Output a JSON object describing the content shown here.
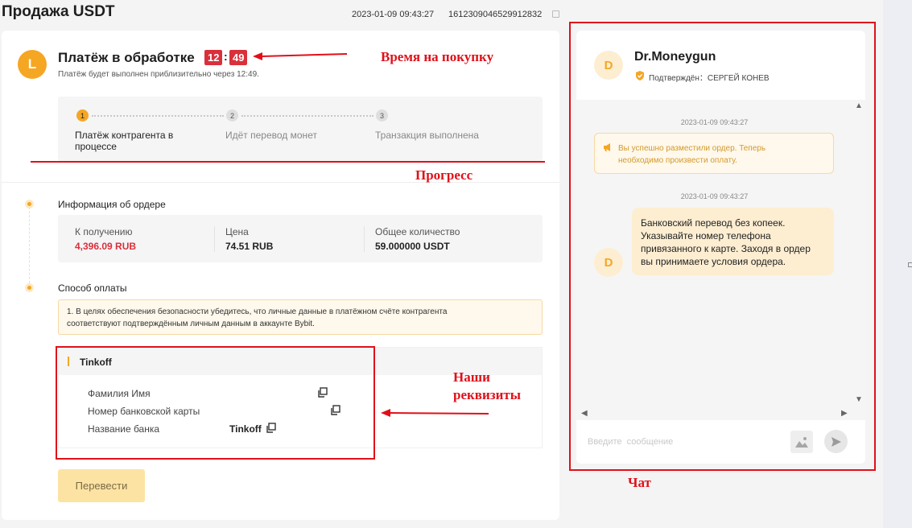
{
  "header": {
    "title": "Продажа USDT",
    "datetime": "2023-01-09 09:43:27",
    "order_id": "1612309046529912832"
  },
  "status": {
    "avatar_letter": "L",
    "title": "Платёж в обработке",
    "timer_minutes": "12",
    "timer_separator": ":",
    "timer_seconds": "49",
    "subtitle": "Платёж будет выполнен приблизительно через 12:49."
  },
  "progress": {
    "steps": [
      {
        "number": "1",
        "label": "Платёж контрагента в процессе",
        "active": true
      },
      {
        "number": "2",
        "label": "Идёт перевод монет",
        "active": false
      },
      {
        "number": "3",
        "label": "Транзакция выполнена",
        "active": false
      }
    ]
  },
  "order_info": {
    "title": "Информация об ордере",
    "items": [
      {
        "label": "К получению",
        "value": "4,396.09 RUB"
      },
      {
        "label": "Цена",
        "value": "74.51 RUB"
      },
      {
        "label": "Общее количество",
        "value": "59.000000 USDT"
      }
    ]
  },
  "payment": {
    "title": "Способ оплаты",
    "warning_line1": "1. В целях обеспечения безопасности убедитесь, что личные данные в платёжном счёте контрагента",
    "warning_line2": "соответствуют подтверждённым личным данным в аккаунте Bybit.",
    "method_name": "Tinkoff",
    "rows": [
      {
        "label": "Фамилия Имя",
        "value": ""
      },
      {
        "label": "Номер банковской карты",
        "value": ""
      },
      {
        "label": "Название банка",
        "value": "Tinkoff"
      }
    ],
    "transfer_button": "Перевести"
  },
  "chat": {
    "avatar_letter": "D",
    "name": "Dr.Moneygun",
    "verified_text": "Подтверждён：СЕРГЕЙ КОНЕВ",
    "messages": [
      {
        "time": "2023-01-09 09:43:27",
        "system_line1": "Вы успешно разместили ордер. Теперь",
        "system_line2": "необходимо произвести оплату."
      },
      {
        "time": "2023-01-09 09:43:27",
        "lines": [
          "Банковский перевод без копеек.",
          "Указывайте номер телефона",
          "привязанного к карте. Заходя в ордер",
          "вы принимаете условия ордера."
        ]
      }
    ],
    "input_placeholder": "Введите  сообщение"
  },
  "annotations": {
    "time_label": "Время на покупку",
    "progress_label": "Прогресс",
    "details_line1": "Наши",
    "details_line2": "реквизиты",
    "chat_label": "Чат"
  },
  "colors": {
    "accent": "#f5a623",
    "timer_red": "#d9303b",
    "annotation_red": "#e0101a",
    "warning_bg": "#fff8ec"
  }
}
